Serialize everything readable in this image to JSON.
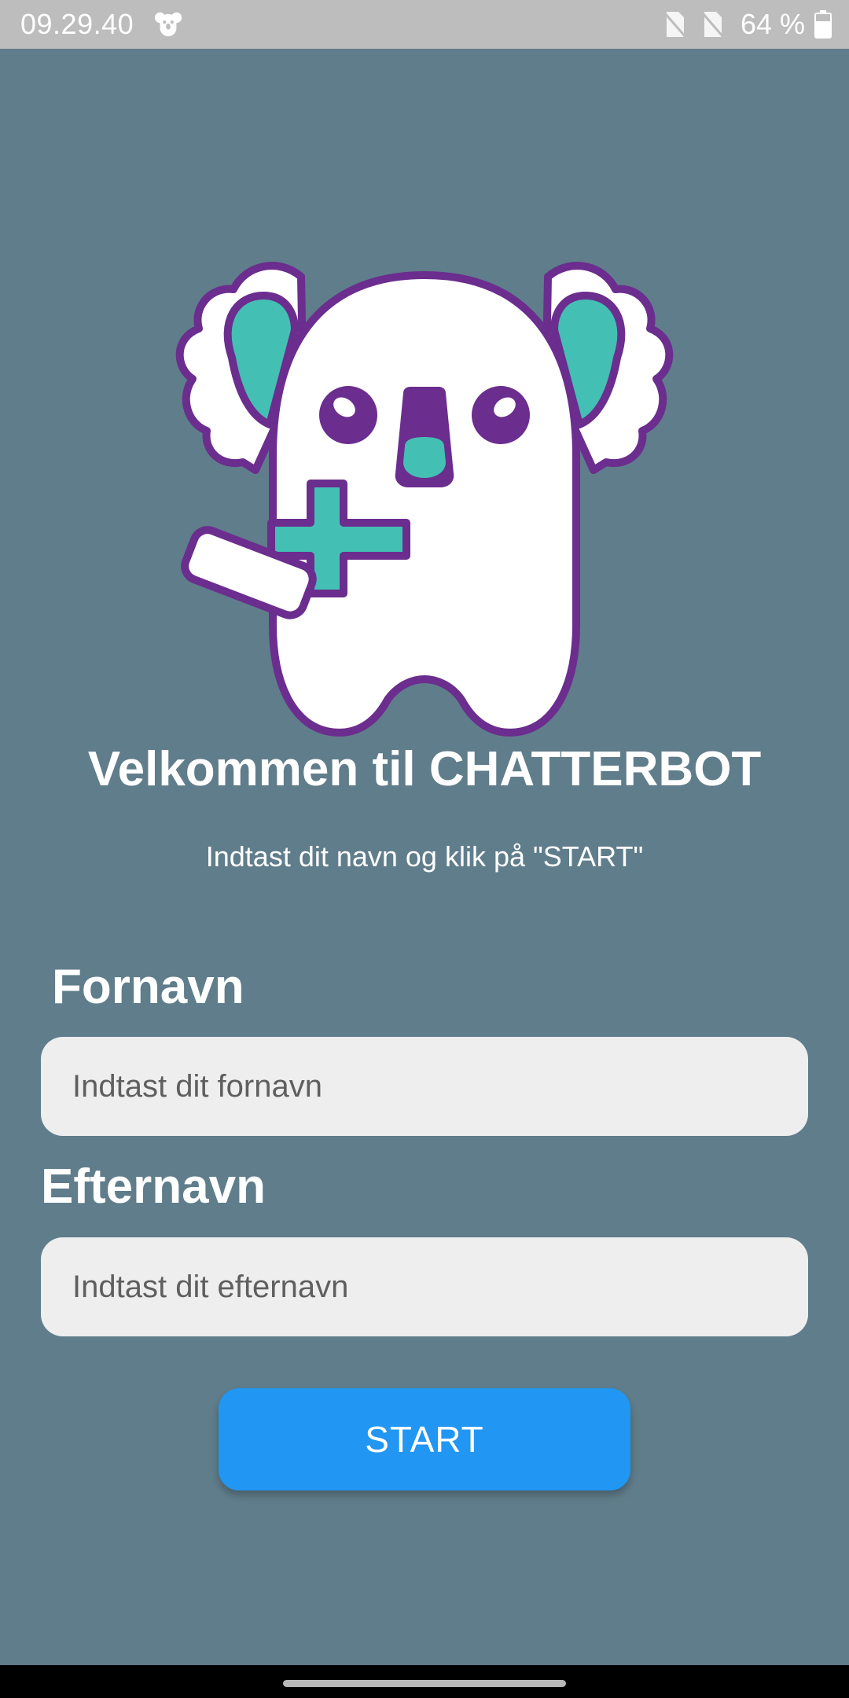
{
  "status_bar": {
    "time": "09.29.40",
    "battery": "64 %",
    "app_icon": "koala-notification-icon",
    "sim_icons": [
      "no-sim-icon",
      "no-sim-icon"
    ],
    "battery_icon": "battery-icon"
  },
  "welcome": {
    "title": "Velkommen til CHATTERBOT",
    "subtitle": "Indtast dit navn og klik på \"START\""
  },
  "form": {
    "first_name_label": "Fornavn",
    "first_name_placeholder": "Indtast dit fornavn",
    "first_name_value": "",
    "last_name_label": "Efternavn",
    "last_name_placeholder": "Indtast dit efternavn",
    "last_name_value": "",
    "start_label": "START"
  },
  "mascot": {
    "icon": "koala-mascot-with-bandage",
    "colors": {
      "outline": "#6b2d8e",
      "accent": "#44bfb4",
      "fill": "#ffffff"
    }
  },
  "colors": {
    "background": "#607d8b",
    "status_bar": "#bdbdbd",
    "input_background": "#eeeeee",
    "button": "#2196f3",
    "nav_bar": "#000000"
  }
}
